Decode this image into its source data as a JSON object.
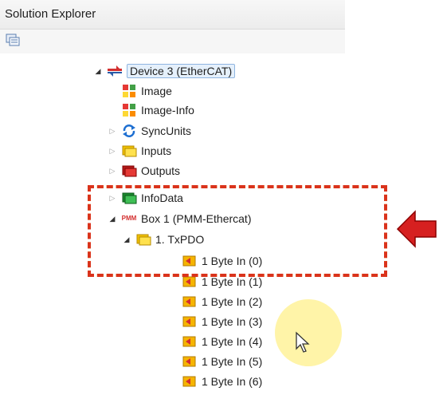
{
  "panel": {
    "title": "Solution Explorer",
    "toolbar_icon": "properties-icon"
  },
  "tree": {
    "device": {
      "label": "Device 3 (EtherCAT)",
      "icon": "ethercat-device-icon"
    },
    "image": {
      "label": "Image",
      "icon": "image-icon"
    },
    "image_info": {
      "label": "Image-Info",
      "icon": "image-info-icon"
    },
    "syncunits": {
      "label": "SyncUnits",
      "icon": "sync-icon"
    },
    "inputs": {
      "label": "Inputs",
      "icon": "folder-yellow-icon"
    },
    "outputs": {
      "label": "Outputs",
      "icon": "folder-red-icon"
    },
    "infodata": {
      "label": "InfoData",
      "icon": "folder-green-icon"
    },
    "box": {
      "label": "Box 1 (PMM-Ethercat)",
      "icon_text": "PMM"
    },
    "txpdo": {
      "label": "1. TxPDO",
      "icon": "folder-yellow-icon"
    },
    "vars": [
      {
        "label": "1 Byte In (0)"
      },
      {
        "label": "1 Byte In (1)"
      },
      {
        "label": "1 Byte In (2)"
      },
      {
        "label": "1 Byte In (3)"
      },
      {
        "label": "1 Byte In (4)"
      },
      {
        "label": "1 Byte In (5)"
      },
      {
        "label": "1 Byte In (6)"
      }
    ]
  },
  "colors": {
    "highlight_red": "#d62020",
    "highlight_yellow": "#ffea00",
    "arrow": "#d62020"
  }
}
